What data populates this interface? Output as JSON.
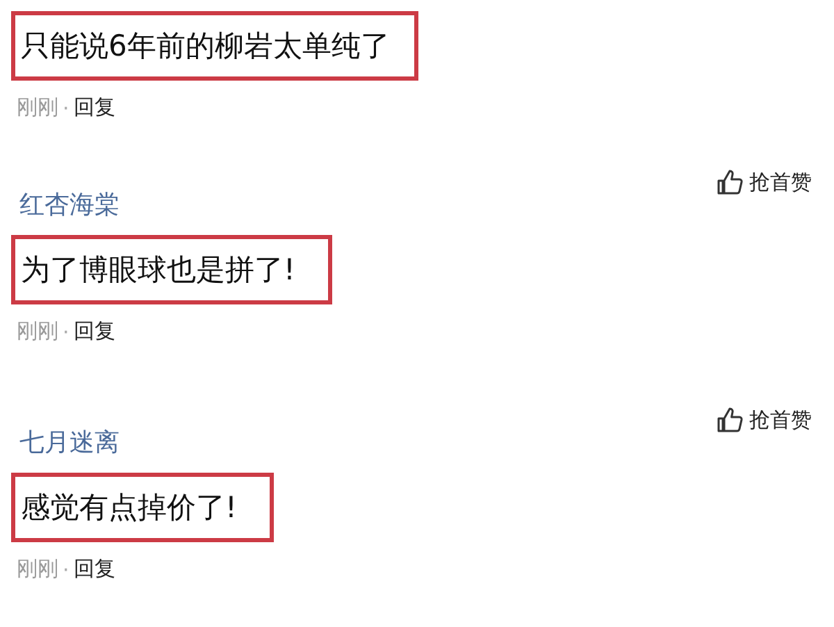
{
  "comments": [
    {
      "text": "只能说6年前的柳岩太单纯了",
      "highlighted": true,
      "time": "刚刚",
      "separator": "·",
      "reply": "回复"
    },
    {
      "author": "红杏海棠",
      "like": "抢首赞",
      "text": "为了博眼球也是拼了!",
      "highlighted": true,
      "time": "刚刚",
      "separator": "·",
      "reply": "回复"
    },
    {
      "author": "七月迷离",
      "like": "抢首赞",
      "text": "感觉有点掉价了!",
      "highlighted": true,
      "time": "刚刚",
      "separator": "·",
      "reply": "回复"
    }
  ]
}
